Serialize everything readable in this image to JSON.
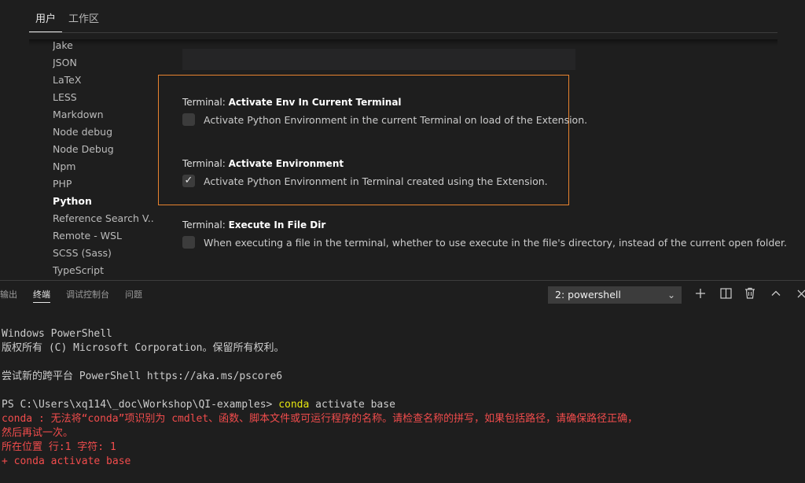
{
  "settings_tabs": [
    "用户",
    "工作区"
  ],
  "toc": [
    "Jake",
    "JSON",
    "LaTeX",
    "LESS",
    "Markdown",
    "Node debug",
    "Node Debug",
    "Npm",
    "PHP",
    "Python",
    "Reference Search V...",
    "Remote - WSL",
    "SCSS (Sass)",
    "TypeScript"
  ],
  "toc_active": "Python",
  "settings": [
    {
      "prefix": "Terminal: ",
      "name": "Activate Env In Current Terminal",
      "desc": "Activate Python Environment in the current Terminal on load of the Extension.",
      "checked": false
    },
    {
      "prefix": "Terminal: ",
      "name": "Activate Environment",
      "desc": "Activate Python Environment in Terminal created using the Extension.",
      "checked": true
    },
    {
      "prefix": "Terminal: ",
      "name": "Execute In File Dir",
      "desc": "When executing a file in the terminal, whether to use execute in the file's directory, instead of the current open folder.",
      "checked": false
    }
  ],
  "panel": {
    "tabs": [
      "输出",
      "终端",
      "调试控制台",
      "问题"
    ],
    "active_tab": "终端",
    "terminal_select": "2: powershell"
  },
  "terminal": {
    "line1": "Windows PowerShell",
    "line2": "版权所有 (C) Microsoft Corporation。保留所有权利。",
    "line3": "尝试新的跨平台 PowerShell https://aka.ms/pscore6",
    "prompt": "PS C:\\Users\\xq114\\_doc\\Workshop\\QI-examples> ",
    "cmd_name": "conda",
    "cmd_args": " activate base",
    "err1": "conda : 无法将“conda”项识别为 cmdlet、函数、脚本文件或可运行程序的名称。请检查名称的拼写，如果包括路径，请确保路径正确，",
    "err2": "然后再试一次。",
    "err3": "所在位置 行:1 字符: 1",
    "err4": "+ conda activate base"
  },
  "colors": {
    "highlight_border": "#e8832f",
    "error_text": "#f14c4c",
    "command_text": "#e5e510"
  }
}
